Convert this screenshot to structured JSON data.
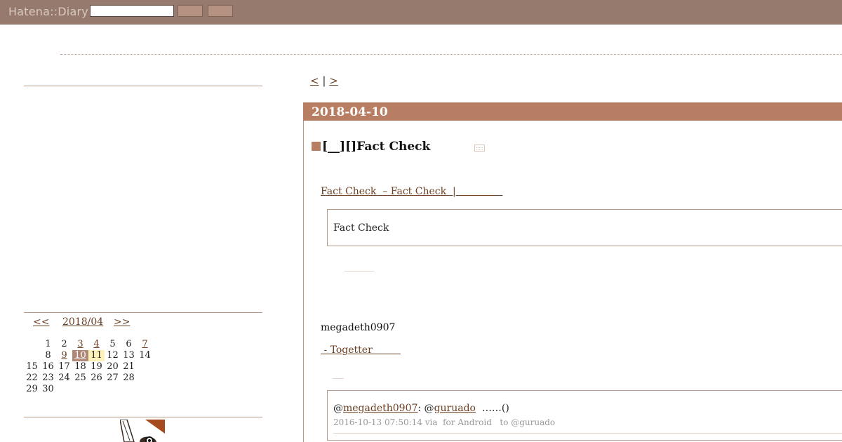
{
  "header": {
    "logo": "Hatena::Diary",
    "search_value": "",
    "search_button_label": "",
    "go_button_label": ""
  },
  "pager": {
    "prev": "<",
    "separator": "|",
    "next": ">"
  },
  "calendar": {
    "prev": "<<",
    "month": "2018/04",
    "next": ">>",
    "weeks": [
      [
        {
          "d": "",
          "link": false,
          "state": ""
        },
        {
          "d": "1",
          "link": false,
          "state": ""
        },
        {
          "d": "2",
          "link": false,
          "state": ""
        },
        {
          "d": "3",
          "link": true,
          "state": ""
        },
        {
          "d": "4",
          "link": true,
          "state": ""
        },
        {
          "d": "5",
          "link": false,
          "state": ""
        },
        {
          "d": "6",
          "link": false,
          "state": ""
        },
        {
          "d": "7",
          "link": true,
          "state": ""
        }
      ],
      [
        {
          "d": "",
          "link": false,
          "state": ""
        },
        {
          "d": "8",
          "link": false,
          "state": ""
        },
        {
          "d": "9",
          "link": true,
          "state": ""
        },
        {
          "d": "10",
          "link": true,
          "state": "today"
        },
        {
          "d": "11",
          "link": false,
          "state": "recent"
        },
        {
          "d": "12",
          "link": false,
          "state": ""
        },
        {
          "d": "13",
          "link": false,
          "state": ""
        },
        {
          "d": "14",
          "link": false,
          "state": ""
        }
      ],
      [
        {
          "d": "15",
          "link": false,
          "state": ""
        },
        {
          "d": "16",
          "link": false,
          "state": ""
        },
        {
          "d": "17",
          "link": false,
          "state": ""
        },
        {
          "d": "18",
          "link": false,
          "state": ""
        },
        {
          "d": "19",
          "link": false,
          "state": ""
        },
        {
          "d": "20",
          "link": false,
          "state": ""
        },
        {
          "d": "21",
          "link": false,
          "state": ""
        }
      ],
      [
        {
          "d": "22",
          "link": false,
          "state": ""
        },
        {
          "d": "23",
          "link": false,
          "state": ""
        },
        {
          "d": "24",
          "link": false,
          "state": ""
        },
        {
          "d": "25",
          "link": false,
          "state": ""
        },
        {
          "d": "26",
          "link": false,
          "state": ""
        },
        {
          "d": "27",
          "link": false,
          "state": ""
        },
        {
          "d": "28",
          "link": false,
          "state": ""
        }
      ],
      [
        {
          "d": "29",
          "link": false,
          "state": ""
        },
        {
          "d": "30",
          "link": false,
          "state": ""
        }
      ]
    ]
  },
  "entry": {
    "date": "2018-04-10",
    "title": "[__][]Fact Check",
    "source_link": "Fact Check  – Fact Check  |               ",
    "quote": "Fact Check",
    "author": "megadeth0907",
    "togetter_link": " - Togetter         "
  },
  "tweet": {
    "prefix": "@",
    "user": "megadeth0907",
    "mid": ": @",
    "reply_to": "guruado",
    "suffix": "  ……()",
    "meta": "2016-10-13 07:50:14 via  for Android   to @guruado"
  },
  "colors": {
    "topbar": "#967a6d",
    "accent": "#b87e63",
    "link": "#6b3f22",
    "border": "#b89a8a"
  }
}
